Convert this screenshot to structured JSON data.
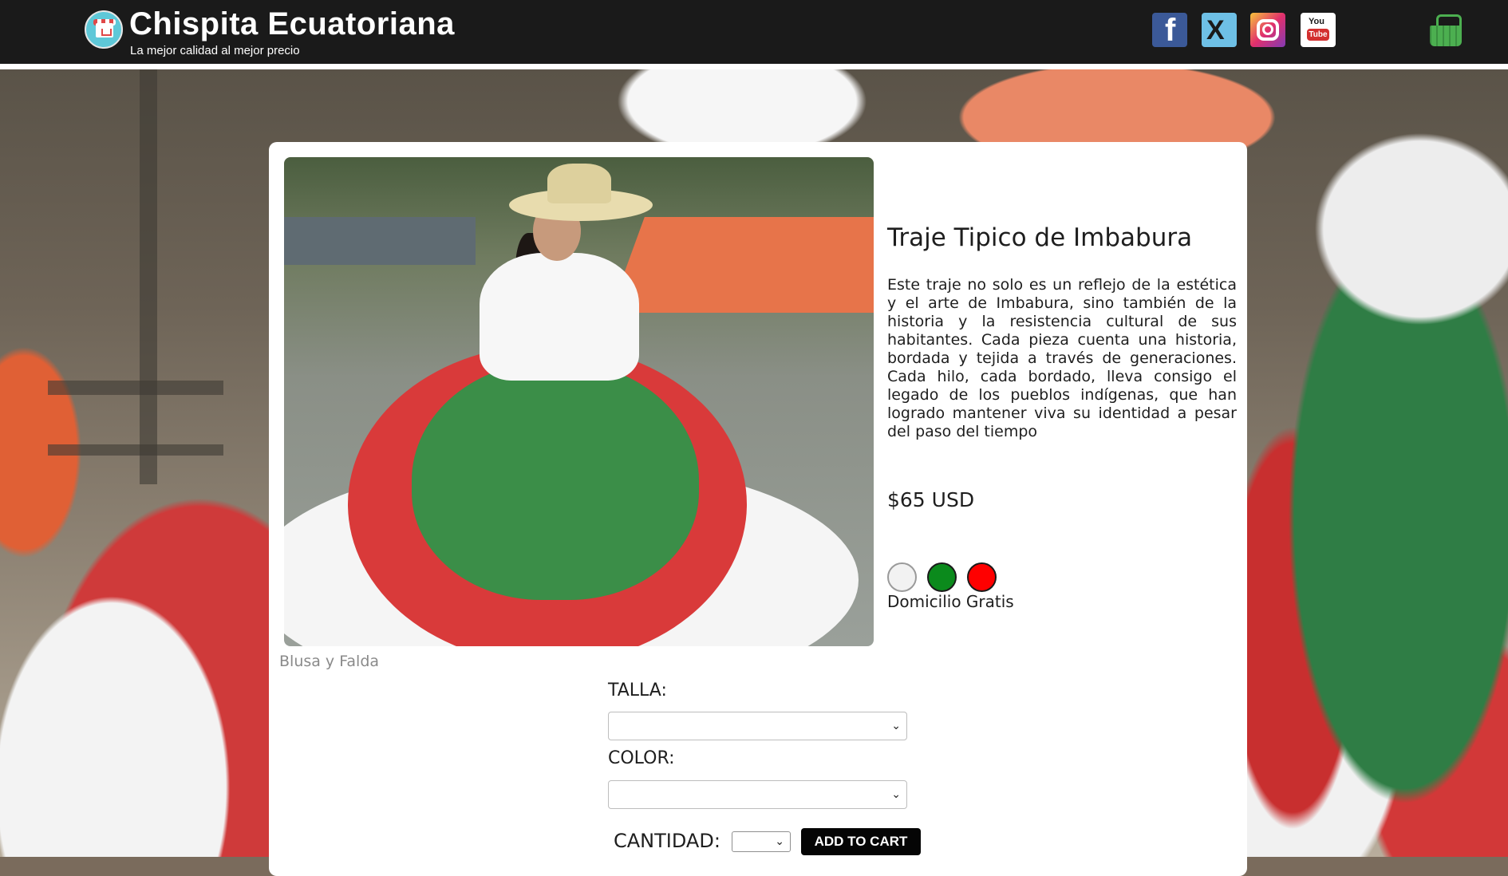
{
  "header": {
    "brand_name": "Chispita Ecuatoriana",
    "tagline": "La mejor calidad al mejor precio",
    "social": [
      "facebook-icon",
      "x-twitter-icon",
      "instagram-icon",
      "youtube-icon"
    ],
    "youtube_you": "You",
    "youtube_tube": "Tube",
    "cart_icon": "shopping-basket-icon"
  },
  "product": {
    "title": "Traje Tipico de Imbabura",
    "description": "Este traje no solo es un reflejo de la estética y el arte de Imbabura, sino también de la historia y la resistencia cultural de sus habitantes. Cada pieza cuenta una historia, bordada y tejida a través de generaciones. Cada hilo, cada bordado, lleva consigo el legado de los pueblos indígenas, que han logrado mantener viva su identidad a pesar del paso del tiempo",
    "price": "$65 USD",
    "image_caption": "Blusa y Falda",
    "color_swatches": [
      "#f2f2f2",
      "#0b8a1c",
      "#ff0000"
    ],
    "delivery": "Domicilio Gratis"
  },
  "form": {
    "size_label": "TALLA:",
    "size_value": "",
    "color_label": "COLOR:",
    "color_value": "",
    "quantity_label": "CANTIDAD:",
    "quantity_value": "",
    "add_to_cart": "ADD TO CART"
  },
  "colors": {
    "header_bg": "#1a1a1a",
    "button_bg": "#050505"
  }
}
